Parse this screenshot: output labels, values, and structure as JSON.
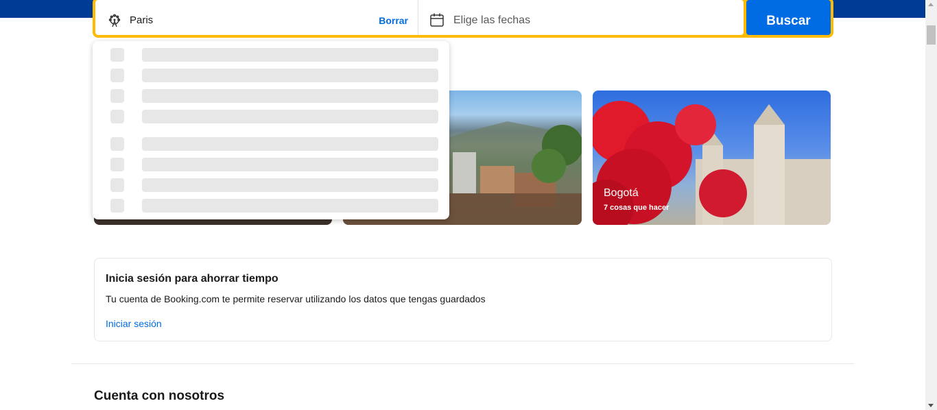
{
  "search": {
    "destination_value": "Paris",
    "clear_label": "Borrar",
    "dates_placeholder": "Elige las fechas",
    "search_label": "Buscar"
  },
  "cards": [
    {
      "title": "",
      "subtitle": ""
    },
    {
      "title": "",
      "subtitle": ""
    },
    {
      "title": "Bogotá",
      "subtitle": "7 cosas que hacer"
    }
  ],
  "signin": {
    "title": "Inicia sesión para ahorrar tiempo",
    "text": "Tu cuenta de Booking.com te permite reservar utilizando los datos que tengas guardados",
    "link": "Iniciar sesión"
  },
  "section": {
    "heading": "Cuenta con nosotros"
  },
  "colors": {
    "brand_blue": "#003b95",
    "action_blue": "#006ce4",
    "accent_yellow": "#febb02"
  },
  "icons": {
    "destination": "ferris-wheel-icon",
    "dates": "calendar-icon"
  }
}
